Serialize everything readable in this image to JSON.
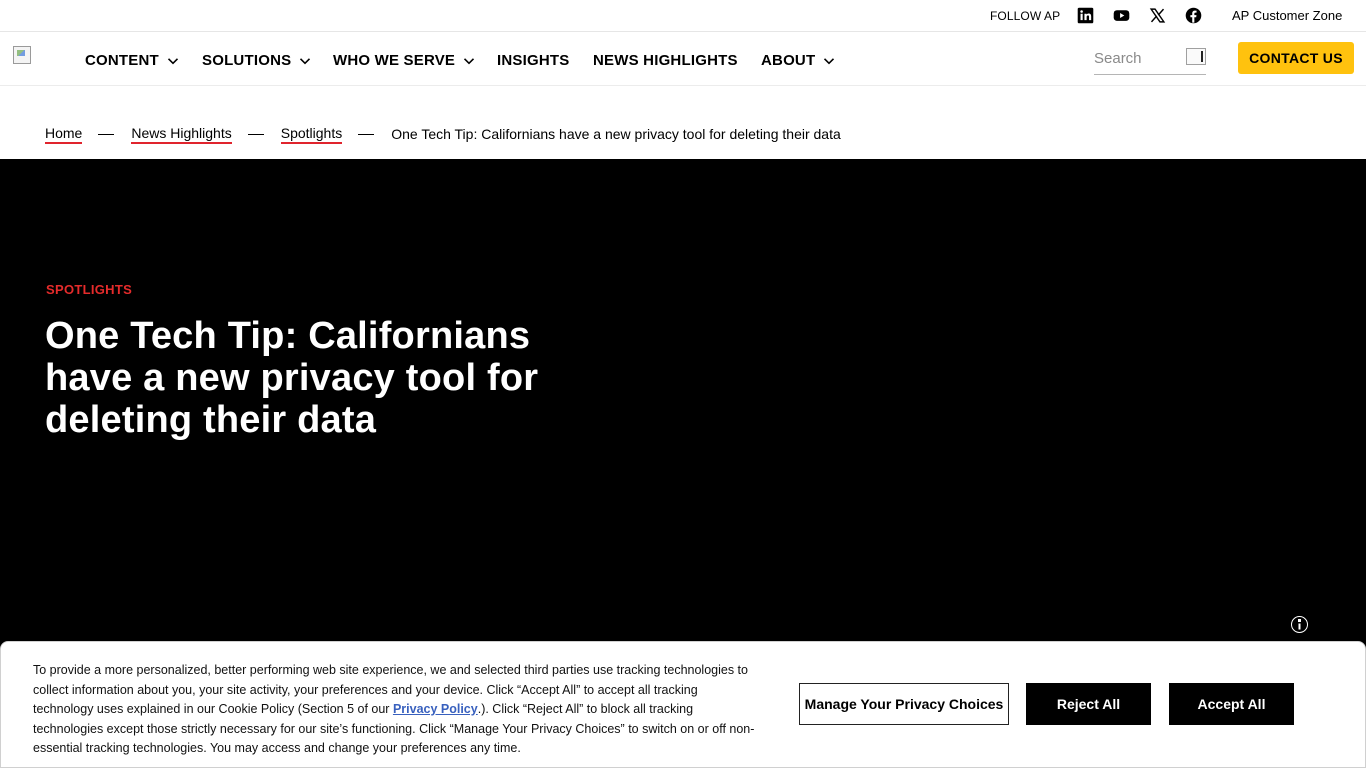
{
  "utility": {
    "follow_label": "FOLLOW AP",
    "social_icons": [
      "linkedin-icon",
      "youtube-icon",
      "x-icon",
      "facebook-icon"
    ],
    "customer_zone": "AP Customer Zone"
  },
  "nav": {
    "items": [
      {
        "label": "CONTENT",
        "has_dropdown": true
      },
      {
        "label": "SOLUTIONS",
        "has_dropdown": true
      },
      {
        "label": "WHO WE SERVE",
        "has_dropdown": true
      },
      {
        "label": "INSIGHTS",
        "has_dropdown": false
      },
      {
        "label": "NEWS HIGHLIGHTS",
        "has_dropdown": false
      },
      {
        "label": "ABOUT",
        "has_dropdown": true
      }
    ],
    "search_placeholder": "Search",
    "contact_label": "CONTACT US"
  },
  "breadcrumb": {
    "links": [
      "Home",
      "News Highlights",
      "Spotlights"
    ],
    "current": "One Tech Tip: Californians have a new privacy tool for deleting their data"
  },
  "hero": {
    "tag": "SPOTLIGHTS",
    "title": "One Tech Tip: Californians have a new privacy tool for deleting their data"
  },
  "cookie": {
    "text_before_link": "To provide a more personalized, better performing web site experience, we and selected third parties use tracking technologies to collect information about you, your site activity, your preferences and your device. Click “Accept All” to accept all tracking technology uses explained in our Cookie Policy (Section 5 of our ",
    "link_text": "Privacy Policy",
    "text_after_link": ".). Click “Reject All” to block all tracking technologies except those strictly necessary for our site’s functioning. Click “Manage Your Privacy Choices” to switch on or off non-essential tracking technologies. You may access and change your preferences any time.",
    "manage_label": "Manage Your Privacy Choices",
    "reject_label": "Reject All",
    "accept_label": "Accept All"
  },
  "colors": {
    "accent_yellow": "#ffc20e",
    "tag_red": "#e52b2b",
    "breadcrumb_underline": "#e0242d",
    "link_blue": "#3860be",
    "hero_bg": "#000000"
  }
}
